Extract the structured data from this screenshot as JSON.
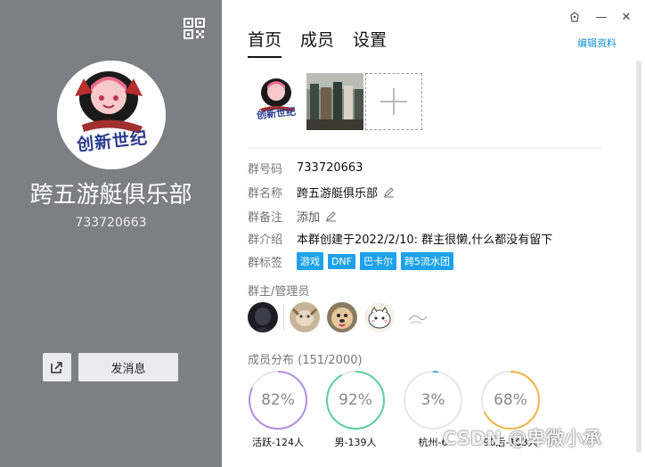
{
  "window": {
    "controls": {
      "skin_icon": "skin-icon",
      "minimize": "—",
      "close": "✕"
    }
  },
  "left": {
    "qr_icon": "qr-code-icon",
    "avatar_text": "创新世纪",
    "group_name": "跨五游艇俱乐部",
    "group_id": "733720663",
    "share_icon": "share-icon",
    "send_message_label": "发消息"
  },
  "tabs": [
    {
      "label": "首页",
      "active": true
    },
    {
      "label": "成员",
      "active": false
    },
    {
      "label": "设置",
      "active": false
    }
  ],
  "edit_link": "编辑资料",
  "album": {
    "thumb1_text": "创新世纪",
    "add_icon": "plus-icon"
  },
  "info": {
    "number_label": "群号码",
    "number_value": "733720663",
    "name_label": "群名称",
    "name_value": "跨五游艇俱乐部",
    "remark_label": "群备注",
    "remark_value": "添加",
    "intro_label": "群介绍",
    "intro_value": "本群创建于2022/2/10:  群主很懒,什么都没有留下",
    "tags_label": "群标签",
    "tags": [
      "游戏",
      "DNF",
      "巴卡尔",
      "跨5流水团"
    ]
  },
  "admins_title": "群主/管理员",
  "distribution": {
    "title": "成员分布 (151/2000)",
    "items": [
      {
        "pct_text": "82%",
        "pct": 82,
        "color": "#b58ee0",
        "caption": "活跃-124人"
      },
      {
        "pct_text": "92%",
        "pct": 92,
        "color": "#5fcfa2",
        "caption": "男-139人"
      },
      {
        "pct_text": "3%",
        "pct": 3,
        "color": "#4fa3e3",
        "caption": "杭州-6"
      },
      {
        "pct_text": "68%",
        "pct": 68,
        "color": "#f2b447",
        "caption": "90后-103人"
      }
    ]
  },
  "watermark": "CSDN @卑微小承",
  "colors": {
    "left_panel": "#7b8084",
    "accent": "#1a8fd6",
    "tag_bg": "#1da2ea"
  }
}
